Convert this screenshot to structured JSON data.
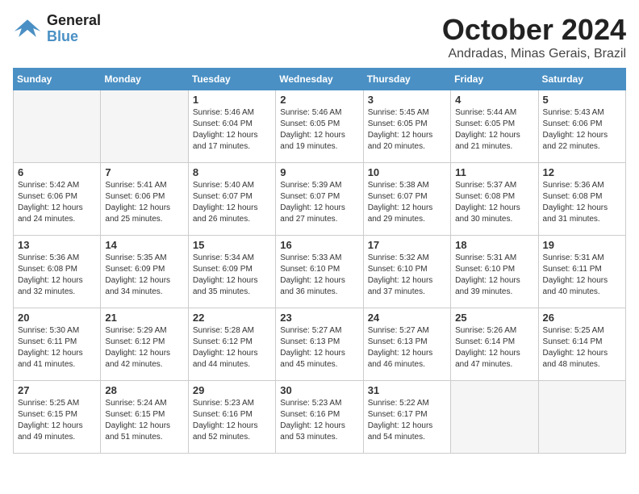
{
  "header": {
    "logo_general": "General",
    "logo_blue": "Blue",
    "month": "October 2024",
    "location": "Andradas, Minas Gerais, Brazil"
  },
  "days_of_week": [
    "Sunday",
    "Monday",
    "Tuesday",
    "Wednesday",
    "Thursday",
    "Friday",
    "Saturday"
  ],
  "weeks": [
    [
      {
        "day": "",
        "info": ""
      },
      {
        "day": "",
        "info": ""
      },
      {
        "day": "1",
        "info": "Sunrise: 5:46 AM\nSunset: 6:04 PM\nDaylight: 12 hours and 17 minutes."
      },
      {
        "day": "2",
        "info": "Sunrise: 5:46 AM\nSunset: 6:05 PM\nDaylight: 12 hours and 19 minutes."
      },
      {
        "day": "3",
        "info": "Sunrise: 5:45 AM\nSunset: 6:05 PM\nDaylight: 12 hours and 20 minutes."
      },
      {
        "day": "4",
        "info": "Sunrise: 5:44 AM\nSunset: 6:05 PM\nDaylight: 12 hours and 21 minutes."
      },
      {
        "day": "5",
        "info": "Sunrise: 5:43 AM\nSunset: 6:06 PM\nDaylight: 12 hours and 22 minutes."
      }
    ],
    [
      {
        "day": "6",
        "info": "Sunrise: 5:42 AM\nSunset: 6:06 PM\nDaylight: 12 hours and 24 minutes."
      },
      {
        "day": "7",
        "info": "Sunrise: 5:41 AM\nSunset: 6:06 PM\nDaylight: 12 hours and 25 minutes."
      },
      {
        "day": "8",
        "info": "Sunrise: 5:40 AM\nSunset: 6:07 PM\nDaylight: 12 hours and 26 minutes."
      },
      {
        "day": "9",
        "info": "Sunrise: 5:39 AM\nSunset: 6:07 PM\nDaylight: 12 hours and 27 minutes."
      },
      {
        "day": "10",
        "info": "Sunrise: 5:38 AM\nSunset: 6:07 PM\nDaylight: 12 hours and 29 minutes."
      },
      {
        "day": "11",
        "info": "Sunrise: 5:37 AM\nSunset: 6:08 PM\nDaylight: 12 hours and 30 minutes."
      },
      {
        "day": "12",
        "info": "Sunrise: 5:36 AM\nSunset: 6:08 PM\nDaylight: 12 hours and 31 minutes."
      }
    ],
    [
      {
        "day": "13",
        "info": "Sunrise: 5:36 AM\nSunset: 6:08 PM\nDaylight: 12 hours and 32 minutes."
      },
      {
        "day": "14",
        "info": "Sunrise: 5:35 AM\nSunset: 6:09 PM\nDaylight: 12 hours and 34 minutes."
      },
      {
        "day": "15",
        "info": "Sunrise: 5:34 AM\nSunset: 6:09 PM\nDaylight: 12 hours and 35 minutes."
      },
      {
        "day": "16",
        "info": "Sunrise: 5:33 AM\nSunset: 6:10 PM\nDaylight: 12 hours and 36 minutes."
      },
      {
        "day": "17",
        "info": "Sunrise: 5:32 AM\nSunset: 6:10 PM\nDaylight: 12 hours and 37 minutes."
      },
      {
        "day": "18",
        "info": "Sunrise: 5:31 AM\nSunset: 6:10 PM\nDaylight: 12 hours and 39 minutes."
      },
      {
        "day": "19",
        "info": "Sunrise: 5:31 AM\nSunset: 6:11 PM\nDaylight: 12 hours and 40 minutes."
      }
    ],
    [
      {
        "day": "20",
        "info": "Sunrise: 5:30 AM\nSunset: 6:11 PM\nDaylight: 12 hours and 41 minutes."
      },
      {
        "day": "21",
        "info": "Sunrise: 5:29 AM\nSunset: 6:12 PM\nDaylight: 12 hours and 42 minutes."
      },
      {
        "day": "22",
        "info": "Sunrise: 5:28 AM\nSunset: 6:12 PM\nDaylight: 12 hours and 44 minutes."
      },
      {
        "day": "23",
        "info": "Sunrise: 5:27 AM\nSunset: 6:13 PM\nDaylight: 12 hours and 45 minutes."
      },
      {
        "day": "24",
        "info": "Sunrise: 5:27 AM\nSunset: 6:13 PM\nDaylight: 12 hours and 46 minutes."
      },
      {
        "day": "25",
        "info": "Sunrise: 5:26 AM\nSunset: 6:14 PM\nDaylight: 12 hours and 47 minutes."
      },
      {
        "day": "26",
        "info": "Sunrise: 5:25 AM\nSunset: 6:14 PM\nDaylight: 12 hours and 48 minutes."
      }
    ],
    [
      {
        "day": "27",
        "info": "Sunrise: 5:25 AM\nSunset: 6:15 PM\nDaylight: 12 hours and 49 minutes."
      },
      {
        "day": "28",
        "info": "Sunrise: 5:24 AM\nSunset: 6:15 PM\nDaylight: 12 hours and 51 minutes."
      },
      {
        "day": "29",
        "info": "Sunrise: 5:23 AM\nSunset: 6:16 PM\nDaylight: 12 hours and 52 minutes."
      },
      {
        "day": "30",
        "info": "Sunrise: 5:23 AM\nSunset: 6:16 PM\nDaylight: 12 hours and 53 minutes."
      },
      {
        "day": "31",
        "info": "Sunrise: 5:22 AM\nSunset: 6:17 PM\nDaylight: 12 hours and 54 minutes."
      },
      {
        "day": "",
        "info": ""
      },
      {
        "day": "",
        "info": ""
      }
    ]
  ]
}
